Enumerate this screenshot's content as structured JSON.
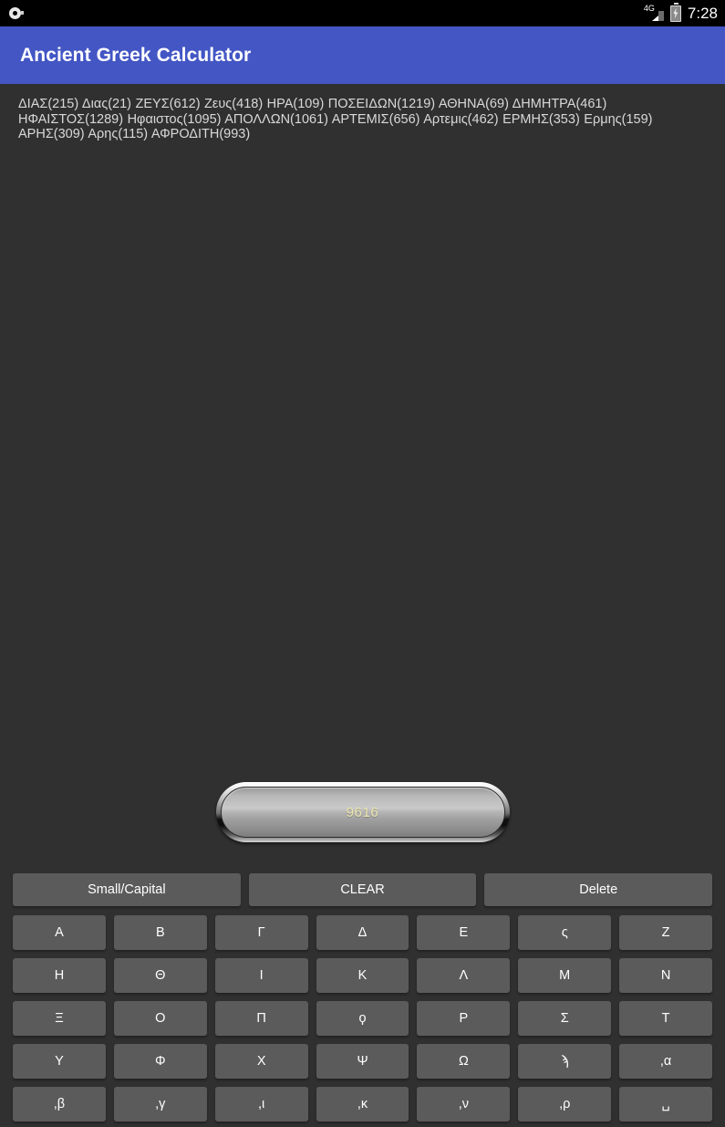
{
  "status_bar": {
    "notification_icon": "notification-dot-icon",
    "network_label": "4G",
    "signal_icon": "signal-triangle-icon",
    "battery_icon": "battery-charging-icon",
    "time": "7:28"
  },
  "app_bar": {
    "title": "Ancient Greek Calculator"
  },
  "history": {
    "text": "ΔΙΑΣ(215) Διας(21) ΖΕΥΣ(612) Ζευς(418) ΗΡΑ(109) ΠΟΣΕΙΔΩΝ(1219) ΑΘΗΝΑ(69) ΔΗΜΗΤΡΑ(461) ΗΦΑΙΣΤΟΣ(1289) Ηφαιστος(1095) ΑΠΟΛΛΩΝ(1061) ΑΡΤΕΜΙΣ(656) Αρτεμις(462) ΕΡΜΗΣ(353) Ερμης(159) ΑΡΗΣ(309) Αρης(115) ΑΦΡΟΔΙΤΗ(993)",
    "entries": [
      {
        "name": "ΔΙΑΣ",
        "value": 215
      },
      {
        "name": "Διας",
        "value": 21
      },
      {
        "name": "ΖΕΥΣ",
        "value": 612
      },
      {
        "name": "Ζευς",
        "value": 418
      },
      {
        "name": "ΗΡΑ",
        "value": 109
      },
      {
        "name": "ΠΟΣΕΙΔΩΝ",
        "value": 1219
      },
      {
        "name": "ΑΘΗΝΑ",
        "value": 69
      },
      {
        "name": "ΔΗΜΗΤΡΑ",
        "value": 461
      },
      {
        "name": "ΗΦΑΙΣΤΟΣ",
        "value": 1289
      },
      {
        "name": "Ηφαιστος",
        "value": 1095
      },
      {
        "name": "ΑΠΟΛΛΩΝ",
        "value": 1061
      },
      {
        "name": "ΑΡΤΕΜΙΣ",
        "value": 656
      },
      {
        "name": "Αρτεμις",
        "value": 462
      },
      {
        "name": "ΕΡΜΗΣ",
        "value": 353
      },
      {
        "name": "Ερμης",
        "value": 159
      },
      {
        "name": "ΑΡΗΣ",
        "value": 309
      },
      {
        "name": "Αρης",
        "value": 115
      },
      {
        "name": "ΑΦΡΟΔΙΤΗ",
        "value": 993
      }
    ]
  },
  "display": {
    "value": "9616",
    "text_color": "#ece7ae"
  },
  "function_keys": [
    {
      "id": "small-capital",
      "label": "Small/Capital"
    },
    {
      "id": "clear",
      "label": "CLEAR"
    },
    {
      "id": "delete",
      "label": "Delete"
    }
  ],
  "keypad_rows": [
    [
      {
        "id": "alpha",
        "label": "Α"
      },
      {
        "id": "beta",
        "label": "Β"
      },
      {
        "id": "gamma",
        "label": "Γ"
      },
      {
        "id": "delta",
        "label": "Δ"
      },
      {
        "id": "epsilon",
        "label": "Ε"
      },
      {
        "id": "stigma",
        "label": "ς"
      },
      {
        "id": "zeta",
        "label": "Ζ"
      }
    ],
    [
      {
        "id": "eta",
        "label": "Η"
      },
      {
        "id": "theta",
        "label": "Θ"
      },
      {
        "id": "iota",
        "label": "Ι"
      },
      {
        "id": "kappa",
        "label": "Κ"
      },
      {
        "id": "lambda",
        "label": "Λ"
      },
      {
        "id": "mu",
        "label": "Μ"
      },
      {
        "id": "nu",
        "label": "Ν"
      }
    ],
    [
      {
        "id": "xi",
        "label": "Ξ"
      },
      {
        "id": "omicron",
        "label": "Ο"
      },
      {
        "id": "pi",
        "label": "Π"
      },
      {
        "id": "koppa",
        "label": "ϙ"
      },
      {
        "id": "rho",
        "label": "Ρ"
      },
      {
        "id": "sigma",
        "label": "Σ"
      },
      {
        "id": "tau",
        "label": "Τ"
      }
    ],
    [
      {
        "id": "upsilon",
        "label": "Υ"
      },
      {
        "id": "phi",
        "label": "Φ"
      },
      {
        "id": "chi",
        "label": "Χ"
      },
      {
        "id": "psi",
        "label": "Ψ"
      },
      {
        "id": "omega",
        "label": "Ω"
      },
      {
        "id": "sampi",
        "label": "ϡ"
      },
      {
        "id": "thousand-alpha",
        "label": ",α"
      }
    ],
    [
      {
        "id": "thousand-beta",
        "label": ",β"
      },
      {
        "id": "thousand-gamma",
        "label": ",γ"
      },
      {
        "id": "thousand-iota",
        "label": ",ι"
      },
      {
        "id": "thousand-kappa",
        "label": ",κ"
      },
      {
        "id": "thousand-nu",
        "label": ",ν"
      },
      {
        "id": "thousand-rho",
        "label": ",ρ"
      },
      {
        "id": "space",
        "label": "␣"
      }
    ]
  ],
  "colors": {
    "app_bar": "#4356c4",
    "background": "#303030",
    "key": "#5b5b5b",
    "display_text": "#ece7ae"
  }
}
